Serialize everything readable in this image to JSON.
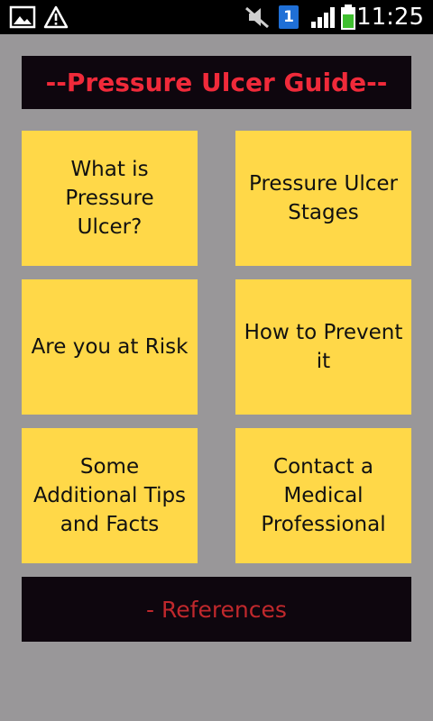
{
  "status_bar": {
    "time": "11:25",
    "notification_count": "1",
    "icons": [
      "gallery-icon",
      "warning-icon",
      "mute-icon",
      "notification-badge-icon",
      "signal-icon",
      "battery-icon"
    ]
  },
  "header": {
    "title": "--Pressure Ulcer Guide--"
  },
  "menu": {
    "items": [
      {
        "label": "What is Pressure Ulcer?"
      },
      {
        "label": "Pressure Ulcer Stages"
      },
      {
        "label": "Are you at Risk"
      },
      {
        "label": "How to Prevent it"
      },
      {
        "label": "Some Additional Tips and Facts"
      },
      {
        "label": "Contact a Medical Professional"
      }
    ]
  },
  "footer": {
    "references_label": "- References"
  },
  "colors": {
    "background": "#999799",
    "tile": "#ffd848",
    "dark_box": "#0e060e",
    "title_text": "#f02a3a",
    "references_text": "#c0282c"
  }
}
